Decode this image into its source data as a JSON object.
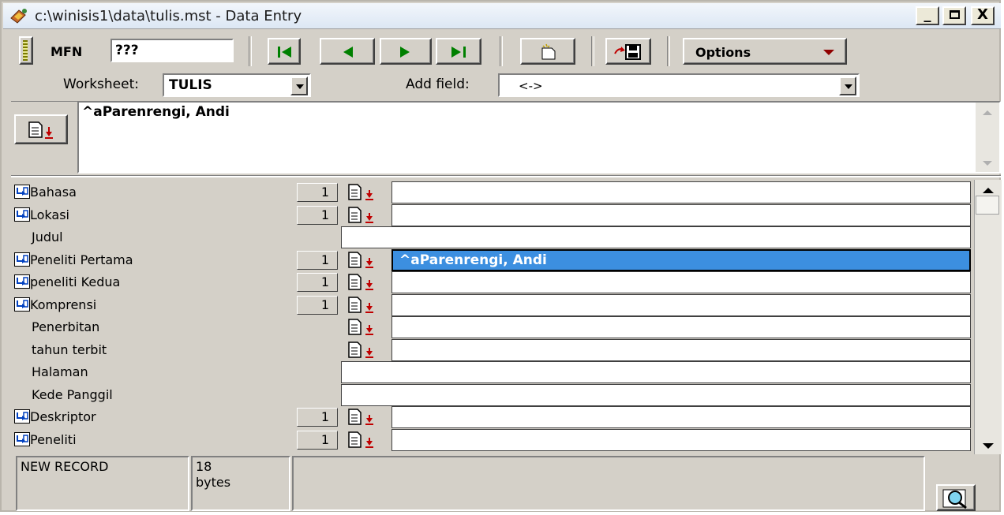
{
  "window": {
    "title": "c:\\winisis1\\data\\tulis.mst - Data Entry",
    "minimize": "_",
    "maximize": "□",
    "close": "X"
  },
  "toolbar": {
    "mfn_label": "MFN",
    "mfn_value": "???",
    "options_label": "Options"
  },
  "worksheet": {
    "label": "Worksheet:",
    "value": "TULIS"
  },
  "add_field": {
    "label": "Add field:",
    "value": "<->"
  },
  "editor": {
    "text": "^aParenrengi, Andi"
  },
  "fields": [
    {
      "label": "Bahasa",
      "repeatable": true,
      "occ": "1",
      "editable": true,
      "value": ""
    },
    {
      "label": "Lokasi",
      "repeatable": true,
      "occ": "1",
      "editable": true,
      "value": ""
    },
    {
      "label": "Judul",
      "repeatable": false,
      "occ": "",
      "editable": false,
      "value": ""
    },
    {
      "label": "Peneliti Pertama",
      "repeatable": true,
      "occ": "1",
      "editable": true,
      "value": "^aParenrengi, Andi",
      "selected": true
    },
    {
      "label": "peneliti Kedua",
      "repeatable": true,
      "occ": "1",
      "editable": true,
      "value": ""
    },
    {
      "label": "Komprensi",
      "repeatable": true,
      "occ": "1",
      "editable": true,
      "value": ""
    },
    {
      "label": "Penerbitan",
      "repeatable": false,
      "occ": "",
      "editable": true,
      "value": ""
    },
    {
      "label": "tahun terbit",
      "repeatable": false,
      "occ": "",
      "editable": true,
      "value": ""
    },
    {
      "label": "Halaman",
      "repeatable": false,
      "occ": "",
      "editable": false,
      "value": ""
    },
    {
      "label": "Kede Panggil",
      "repeatable": false,
      "occ": "",
      "editable": false,
      "value": ""
    },
    {
      "label": "Deskriptor",
      "repeatable": true,
      "occ": "1",
      "editable": true,
      "value": ""
    },
    {
      "label": "Peneliti",
      "repeatable": true,
      "occ": "1",
      "editable": true,
      "value": ""
    }
  ],
  "status": {
    "record": "NEW RECORD",
    "size_number": "18",
    "size_unit": "bytes"
  },
  "colors": {
    "selected": "#3c8fe0",
    "face": "#d4d0c8",
    "edit_arrow": "#c00000"
  }
}
